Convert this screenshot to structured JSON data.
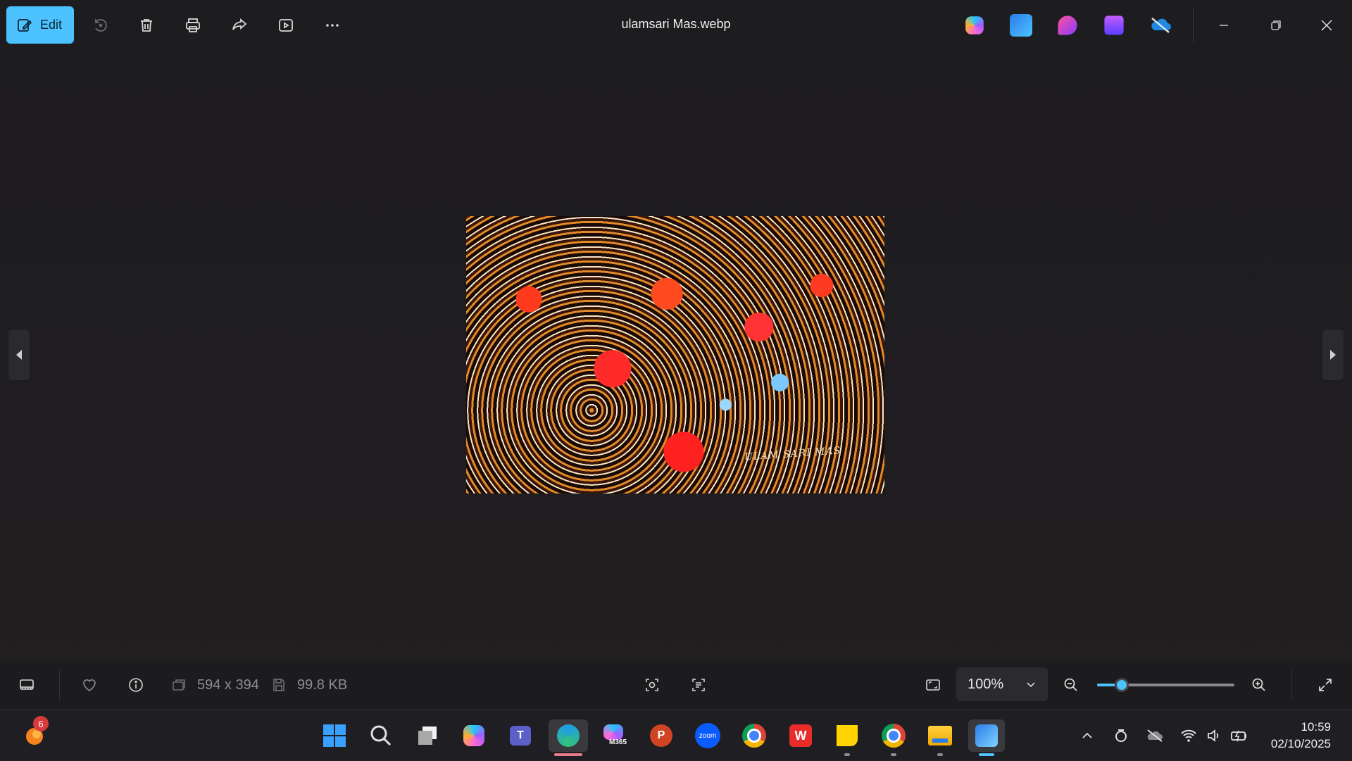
{
  "window": {
    "title": "ulamsari Mas.webp",
    "edit_label": "Edit"
  },
  "toolbar": {
    "icons": [
      "edit-icon",
      "rotate-icon",
      "delete-icon",
      "print-icon",
      "share-icon",
      "slideshow-icon",
      "more-icon"
    ],
    "right_apps": [
      "copilot-icon",
      "photos-icon",
      "designer-icon",
      "clipchamp-icon",
      "onedrive-icon"
    ]
  },
  "image": {
    "caption": "ULAM SARI MAS"
  },
  "status": {
    "dimensions": "594 x 394",
    "file_size": "99.8 KB",
    "zoom": "100%",
    "zoom_slider_value": 0.18
  },
  "taskbar": {
    "notification_count": "6",
    "apps": [
      "start",
      "search",
      "task-view",
      "copilot",
      "teams",
      "edge",
      "m365",
      "powerpoint",
      "zoom",
      "chrome",
      "wps",
      "sticky-notes",
      "chrome-profile",
      "file-explorer",
      "photos"
    ],
    "m365_label": "M365",
    "zoom_label": "zoom",
    "time": "10:59",
    "date": "02/10/2025"
  },
  "colors": {
    "accent": "#4cc2ff",
    "background": "#1f1e21"
  }
}
